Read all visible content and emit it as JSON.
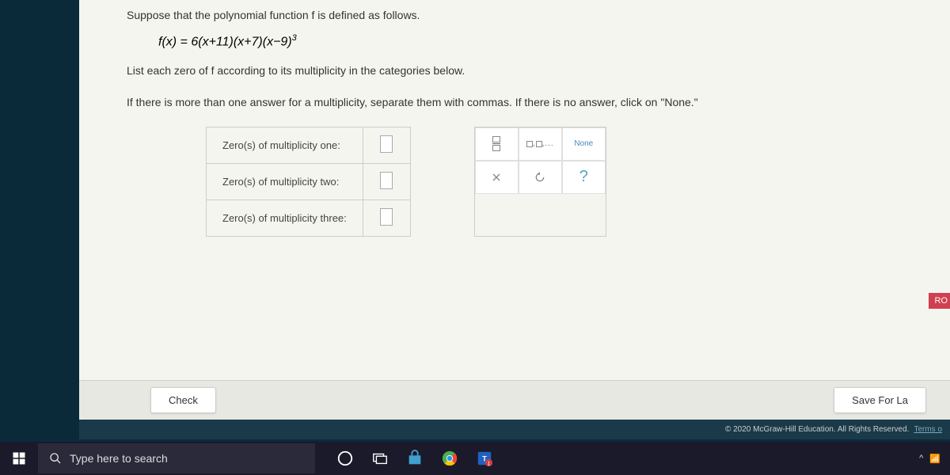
{
  "question": {
    "intro": "Suppose that the polynomial function f is defined as follows.",
    "formula_lhs": "f(x) = ",
    "formula_rhs": "6(x+11)(x+7)(x−9)",
    "formula_exp": "3",
    "instruction": "List each zero of f according to its multiplicity in the categories below.",
    "subinstruction": "If there is more than one answer for a multiplicity, separate them with commas. If there is no answer, click on \"None.\""
  },
  "rows": {
    "r1": "Zero(s) of multiplicity one:",
    "r2": "Zero(s) of multiplicity two:",
    "r3": "Zero(s) of multiplicity three:"
  },
  "tools": {
    "none": "None",
    "commas_hint": "□,□,...",
    "close": "×",
    "reset": "↺",
    "help": "?"
  },
  "buttons": {
    "check": "Check",
    "save": "Save For La"
  },
  "footer": {
    "copyright": "© 2020 McGraw-Hill Education. All Rights Reserved.",
    "terms": "Terms o"
  },
  "taskbar": {
    "search_placeholder": "Type here to search"
  },
  "side_badge": "RO"
}
